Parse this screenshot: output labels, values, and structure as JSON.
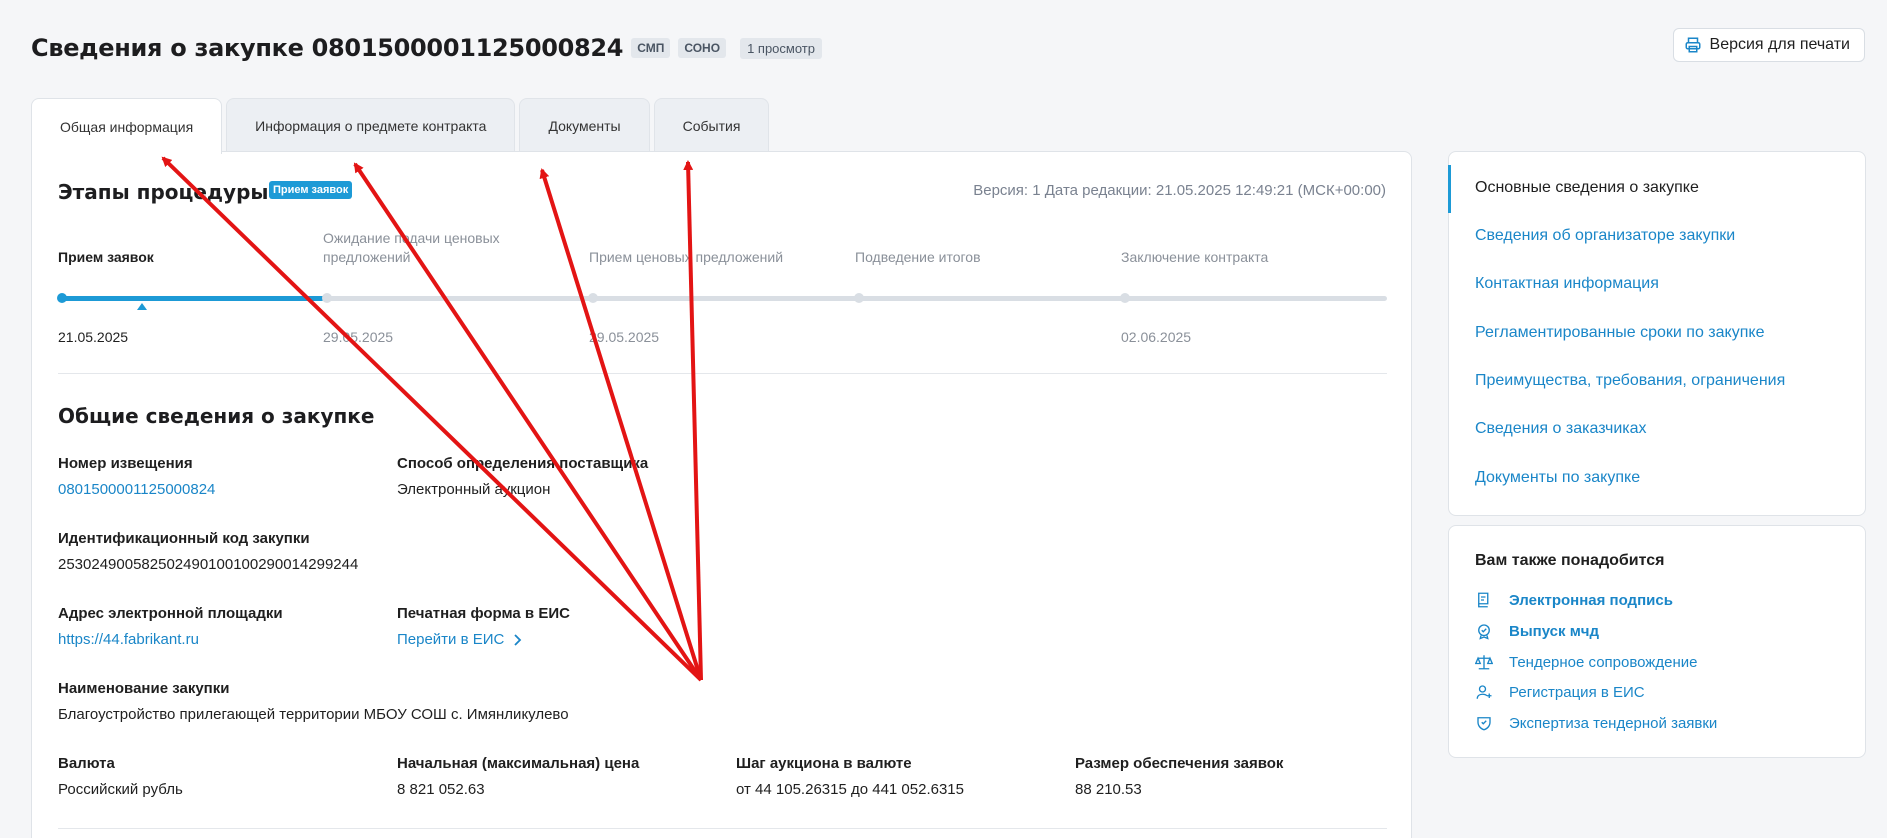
{
  "header": {
    "title": "Сведения о закупке 0801500001125000824",
    "badges": [
      "СМП",
      "СОНО"
    ],
    "views": "1 просмотр",
    "print_label": "Версия для печати"
  },
  "tabs": [
    {
      "label": "Общая информация"
    },
    {
      "label": "Информация о предмете контракта"
    },
    {
      "label": "Документы"
    },
    {
      "label": "События"
    }
  ],
  "stages": {
    "title": "Этапы процедуры",
    "current_badge": "Прием заявок",
    "version": "Версия: 1 Дата редакции: 21.05.2025 12:49:21 (МСК+00:00)",
    "items": [
      {
        "name": "Прием заявок",
        "date": "21.05.2025"
      },
      {
        "name": "Ожидание подачи ценовых предложений",
        "date": "29.05.2025"
      },
      {
        "name": "Прием ценовых предложений",
        "date": "29.05.2025"
      },
      {
        "name": "Подведение итогов",
        "date": ""
      },
      {
        "name": "Заключение контракта",
        "date": "02.06.2025"
      }
    ]
  },
  "general": {
    "title": "Общие сведения о закупке",
    "notice_label": "Номер извещения",
    "notice_value": "0801500001125000824",
    "method_label": "Способ определения поставщика",
    "method_value": "Электронный аукцион",
    "ikz_label": "Идентификационный код закупки",
    "ikz_value": "253024900582502490100100290014299244",
    "platform_label": "Адрес электронной площадки",
    "platform_value": "https://44.fabrikant.ru",
    "print_form_label": "Печатная форма в ЕИС",
    "print_form_value": "Перейти в ЕИС",
    "name_label": "Наименование закупки",
    "name_value": "Благоустройство прилегающей территории МБОУ СОШ с. Имянликулево",
    "currency_label": "Валюта",
    "currency_value": "Российский рубль",
    "price_label": "Начальная (максимальная) цена",
    "price_value": "8 821 052.63",
    "step_label": "Шаг аукциона в валюте",
    "step_value": "от 44 105.26315 до 441 052.6315",
    "security_label": "Размер обеспечения заявок",
    "security_value": "88 210.53"
  },
  "sidebar_nav": [
    {
      "label": "Основные сведения о закупке"
    },
    {
      "label": "Сведения об организаторе закупки"
    },
    {
      "label": "Контактная информация"
    },
    {
      "label": "Регламентированные сроки по закупке"
    },
    {
      "label": "Преимущества, требования, ограничения"
    },
    {
      "label": "Сведения о заказчиках"
    },
    {
      "label": "Документы по закупке"
    }
  ],
  "extras": {
    "title": "Вам также понадобится",
    "items": [
      {
        "label": "Электронная подпись",
        "icon": "certificate-icon"
      },
      {
        "label": "Выпуск мчд",
        "icon": "badge-check-icon"
      },
      {
        "label": "Тендерное сопровождение",
        "icon": "scales-icon"
      },
      {
        "label": "Регистрация в ЕИС",
        "icon": "user-plus-icon"
      },
      {
        "label": "Экспертиза тендерной заявки",
        "icon": "shield-icon"
      }
    ]
  },
  "colors": {
    "accent": "#1d9ad6",
    "link": "#1a86c8",
    "annotation_arrow": "#e31414"
  }
}
